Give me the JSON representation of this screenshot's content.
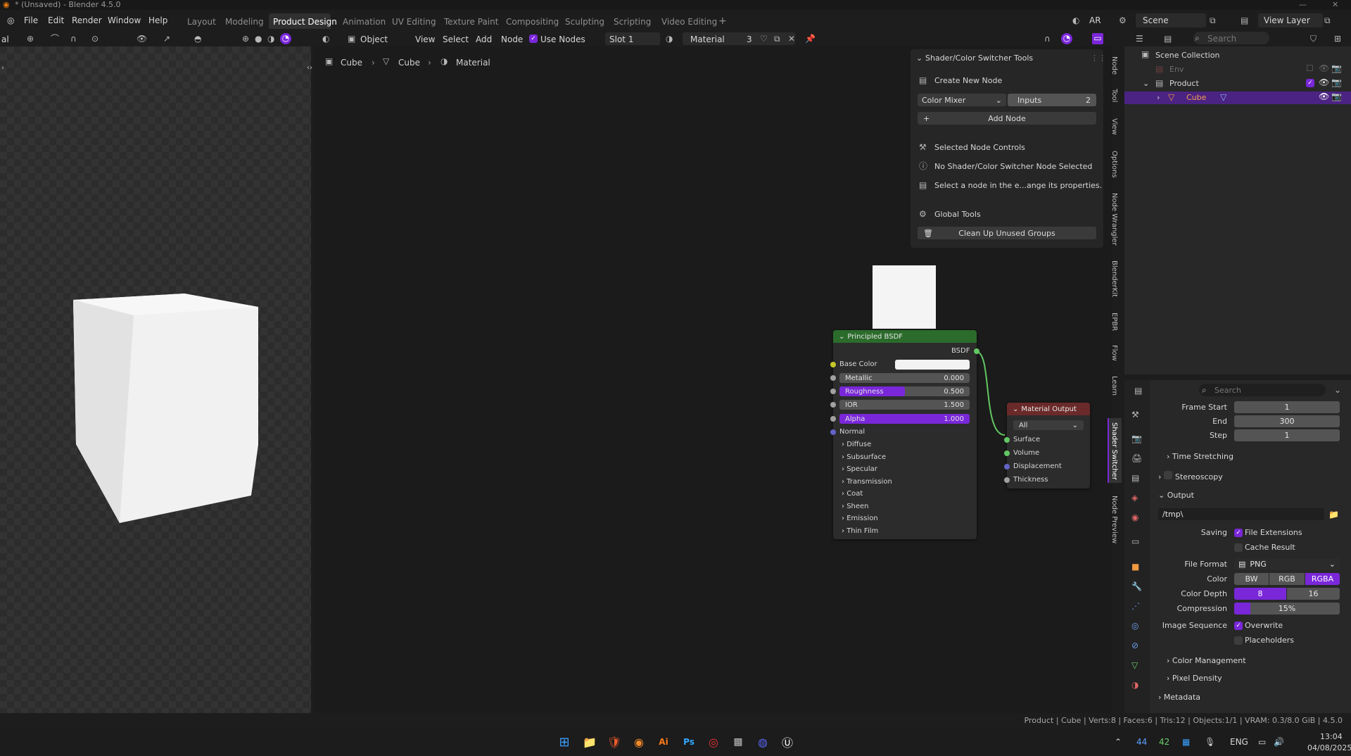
{
  "window": {
    "title": "* (Unsaved) - Blender 4.5.0"
  },
  "menu": [
    "File",
    "Edit",
    "Render",
    "Window",
    "Help"
  ],
  "workspaces": [
    {
      "label": "Layout",
      "active": false
    },
    {
      "label": "Modeling",
      "active": false
    },
    {
      "label": "Product Design",
      "active": true
    },
    {
      "label": "Animation",
      "active": false
    },
    {
      "label": "UV Editing",
      "active": false
    },
    {
      "label": "Texture Paint",
      "active": false
    },
    {
      "label": "Compositing",
      "active": false
    },
    {
      "label": "Sculpting",
      "active": false
    },
    {
      "label": "Scripting",
      "active": false
    },
    {
      "label": "Video Editing",
      "active": false
    }
  ],
  "topright": {
    "ar_label": "AR",
    "scene": "Scene",
    "view_layer": "View Layer"
  },
  "editor_header": {
    "left_trunc": "al",
    "mode": "Object",
    "view": "View",
    "select": "Select",
    "add": "Add",
    "node": "Node",
    "use_nodes": "Use Nodes",
    "slot": "Slot 1",
    "material": "Material",
    "users": "3",
    "outliner_search": "Search"
  },
  "breadcrumb": [
    "Cube",
    "Cube",
    "Material"
  ],
  "npanel": {
    "title": "Shader/Color Switcher Tools",
    "create_new_node": "Create New Node",
    "node_type": "Color Mixer",
    "inputs_label": "Inputs",
    "inputs_value": "2",
    "add_node": "Add Node",
    "selected_controls": "Selected Node Controls",
    "no_selected": "No Shader/Color Switcher Node Selected",
    "select_hint": "Select a node in the e...ange its properties.",
    "global_tools": "Global Tools",
    "clean_up": "Clean Up Unused Groups"
  },
  "side_tabs": [
    "Node",
    "Tool",
    "View",
    "Options",
    "Node Wrangler",
    "BlenderKit",
    "EPBR",
    "Flow",
    "Learn",
    "Shader Switcher",
    "Node Preview"
  ],
  "bsdf": {
    "title": "Principled BSDF",
    "output": "BSDF",
    "base_color": "Base Color",
    "metallic": {
      "label": "Metallic",
      "value": "0.000",
      "fill": 0
    },
    "roughness": {
      "label": "Roughness",
      "value": "0.500",
      "fill": 0.5
    },
    "ior": {
      "label": "IOR",
      "value": "1.500",
      "fill": 0
    },
    "alpha": {
      "label": "Alpha",
      "value": "1.000",
      "fill": 1
    },
    "normal": "Normal",
    "panels": [
      "Diffuse",
      "Subsurface",
      "Specular",
      "Transmission",
      "Coat",
      "Sheen",
      "Emission",
      "Thin Film"
    ]
  },
  "material_output": {
    "title": "Material Output",
    "target": "All",
    "inputs": [
      "Surface",
      "Volume",
      "Displacement",
      "Thickness"
    ]
  },
  "outliner": {
    "search": "Search",
    "scene_collection": "Scene Collection",
    "items": [
      {
        "label": "Env"
      },
      {
        "label": "Product"
      },
      {
        "label": "Cube"
      }
    ]
  },
  "properties": {
    "search": "Search",
    "frame_start_label": "Frame Start",
    "frame_start": "1",
    "end_label": "End",
    "end": "300",
    "step_label": "Step",
    "step": "1",
    "time_stretching": "Time Stretching",
    "stereoscopy": "Stereoscopy",
    "output": "Output",
    "path": "/tmp\\",
    "saving_label": "Saving",
    "file_extensions": "File Extensions",
    "cache_result": "Cache Result",
    "file_format_label": "File Format",
    "file_format": "PNG",
    "color_label": "Color",
    "color_opts": [
      "BW",
      "RGB",
      "RGBA"
    ],
    "color_depth_label": "Color Depth",
    "depth_opts": [
      "8",
      "16"
    ],
    "compression_label": "Compression",
    "compression": "15%",
    "compression_fill": 0.15,
    "image_sequence_label": "Image Sequence",
    "overwrite": "Overwrite",
    "placeholders": "Placeholders",
    "color_management": "Color Management",
    "pixel_density": "Pixel Density",
    "metadata": "Metadata"
  },
  "statusbar": {
    "text": "Product | Cube | Verts:8 | Faces:6 | Tris:12 | Objects:1/1 | VRAM: 0.3/8.0 GiB | 4.5.0"
  },
  "taskbar": {
    "ai": "Ai",
    "ps": "Ps",
    "tray_44": "44",
    "tray_42": "42",
    "lang": "ENG",
    "time": "13:04",
    "date": "04/08/2025"
  },
  "colors": {
    "accent": "#7a27d9",
    "bsdf_header": "#2b6b2b",
    "output_header": "#6b2a2a",
    "socket_shader": "#63c763",
    "socket_float": "#a1a1a1",
    "socket_color": "#c7c729",
    "socket_vector": "#6363c7"
  }
}
